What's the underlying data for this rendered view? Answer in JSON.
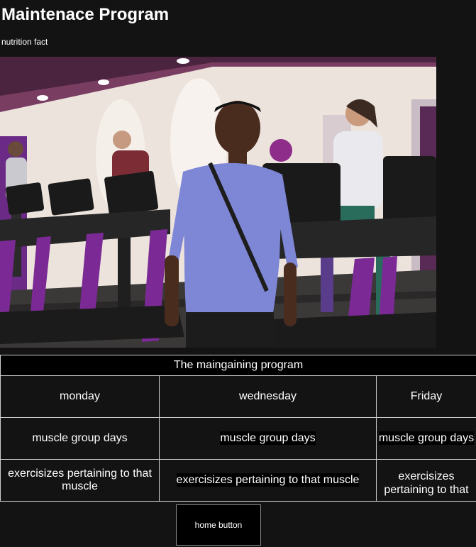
{
  "header": {
    "title": "Maintenace Program",
    "subtitle": "nutrition fact"
  },
  "hero_image": {
    "subject": "gym-treadmill-photo",
    "colors": {
      "wall": "#efe6df",
      "ceiling_trim": "#5b2b4f",
      "treadmill_frame": "#7b2a95",
      "shirt": "#7d86d8",
      "floor": "#3a3a3a"
    }
  },
  "program": {
    "caption": "The maingaining program",
    "days": [
      "monday",
      "wednesday",
      "Friday"
    ],
    "muscle_row": [
      "muscle group days",
      "muscle group days",
      "muscle group days"
    ],
    "exercise_row": [
      "exercisizes pertaining to that muscle",
      "exercisizes pertaining to that muscle",
      "exercisizes pertaining to that muscle"
    ]
  },
  "home": {
    "label": "home button"
  }
}
